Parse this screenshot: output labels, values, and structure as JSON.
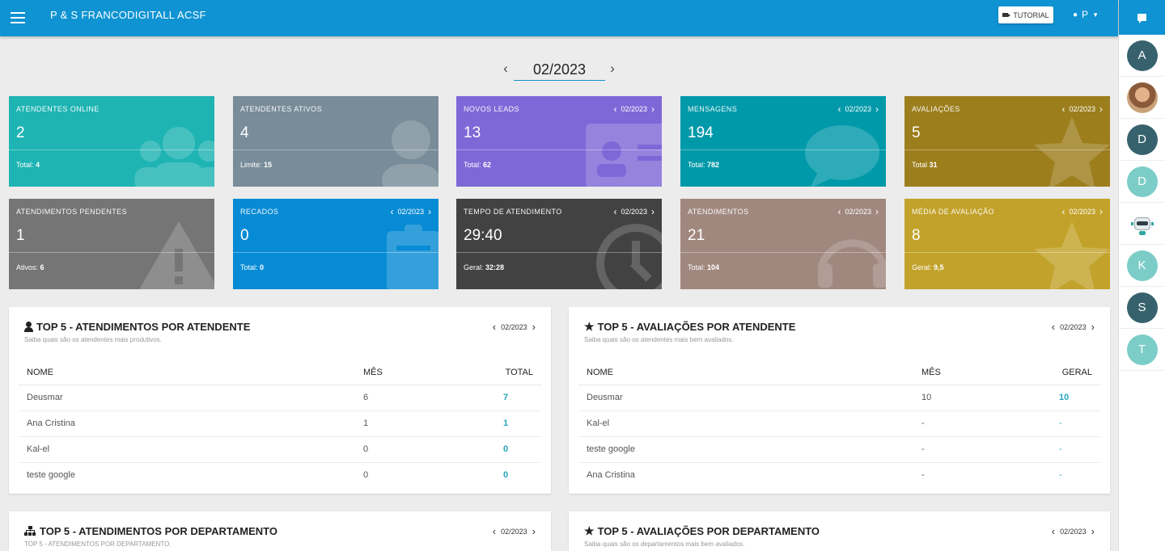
{
  "header": {
    "app_title": "P & S FRANCODIGITALL ACSF",
    "tutorial_label": "TUTORIAL",
    "user_initial": "P"
  },
  "date_nav": {
    "value": "02/2023"
  },
  "cards": {
    "atendentes_online": {
      "label": "ATENDENTES ONLINE",
      "value": "2",
      "sub_label": "Total:",
      "sub_value": "4"
    },
    "atendentes_ativos": {
      "label": "ATENDENTES ATIVOS",
      "value": "4",
      "sub_label": "Limite:",
      "sub_value": "15"
    },
    "novos_leads": {
      "label": "NOVOS LEADS",
      "period": "02/2023",
      "value": "13",
      "sub_label": "Total:",
      "sub_value": "62"
    },
    "mensagens": {
      "label": "MENSAGENS",
      "period": "02/2023",
      "value": "194",
      "sub_label": "Total:",
      "sub_value": "782"
    },
    "avaliacoes": {
      "label": "AVALIAÇÕES",
      "period": "02/2023",
      "value": "5",
      "sub_label": "Total",
      "sub_value": "31"
    },
    "atendimentos_pendentes": {
      "label": "ATENDIMENTOS PENDENTES",
      "value": "1",
      "sub_label": "Ativos:",
      "sub_value": "6"
    },
    "recados": {
      "label": "RECADOS",
      "period": "02/2023",
      "value": "0",
      "sub_label": "Total:",
      "sub_value": "0"
    },
    "tempo_atendimento": {
      "label": "TEMPO DE ATENDIMENTO",
      "period": "02/2023",
      "value": "29:40",
      "sub_label": "Geral:",
      "sub_value": "32:28"
    },
    "atendimentos": {
      "label": "ATENDIMENTOS",
      "period": "02/2023",
      "value": "21",
      "sub_label": "Total:",
      "sub_value": "104"
    },
    "media_avaliacao": {
      "label": "MÉDIA DE AVALIAÇÃO",
      "period": "02/2023",
      "value": "8",
      "sub_label": "Geral:",
      "sub_value": "9,5"
    }
  },
  "panels": {
    "top_atendimentos": {
      "title": "TOP 5 - ATENDIMENTOS POR ATENDENTE",
      "subtitle": "Saiba quais são os atendentes mais produtivos.",
      "period": "02/2023",
      "columns": [
        "NOME",
        "MÊS",
        "TOTAL"
      ],
      "rows": [
        [
          "Deusmar",
          "6",
          "7"
        ],
        [
          "Ana Cristina",
          "1",
          "1"
        ],
        [
          "Kal-el",
          "0",
          "0"
        ],
        [
          "teste google",
          "0",
          "0"
        ]
      ]
    },
    "top_avaliacoes": {
      "title": "TOP 5 - AVALIAÇÕES POR ATENDENTE",
      "subtitle": "Saiba quais são os atendentes mais bem avaliados.",
      "period": "02/2023",
      "columns": [
        "NOME",
        "MÊS",
        "GERAL"
      ],
      "rows": [
        [
          "Deusmar",
          "10",
          "10"
        ],
        [
          "Kal-el",
          "-",
          "-"
        ],
        [
          "teste google",
          "-",
          "-"
        ],
        [
          "Ana Cristina",
          "-",
          "-"
        ]
      ]
    },
    "top_departamento": {
      "title": "TOP 5 - ATENDIMENTOS POR DEPARTAMENTO",
      "subtitle": "TOP 5 - ATENDIMENTOS POR DEPARTAMENTO.",
      "period": "02/2023"
    },
    "top_aval_departamento": {
      "title": "TOP 5 - AVALIAÇÕES POR DEPARTAMENTO",
      "subtitle": "Saiba quais são os departamentos mais bem avaliados.",
      "period": "02/2023"
    }
  },
  "sidebar": {
    "contacts": [
      {
        "initial": "A",
        "style": "dark"
      },
      {
        "initial": "",
        "style": "photo"
      },
      {
        "initial": "D",
        "style": "dark"
      },
      {
        "initial": "D",
        "style": "light"
      },
      {
        "initial": "",
        "style": "bot"
      },
      {
        "initial": "K",
        "style": "light"
      },
      {
        "initial": "S",
        "style": "dark"
      },
      {
        "initial": "T",
        "style": "light"
      }
    ]
  }
}
